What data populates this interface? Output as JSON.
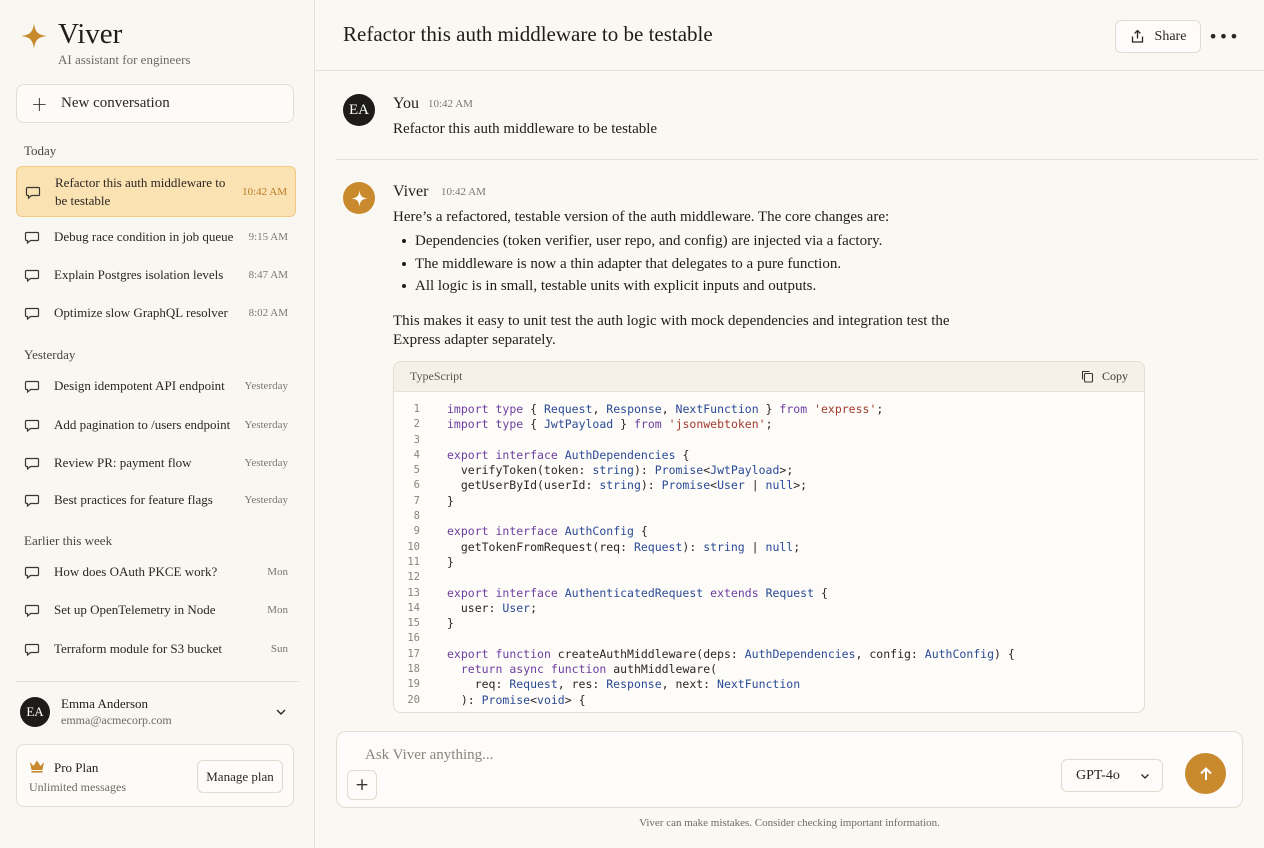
{
  "brand": {
    "name": "Viver",
    "tagline": "AI assistant for engineers"
  },
  "sidebar": {
    "new_conversation": "New conversation",
    "sections": [
      {
        "title": "Today"
      },
      {
        "title": "Yesterday"
      },
      {
        "title": "Earlier this week"
      }
    ],
    "items": [
      {
        "label": "Refactor this auth middleware to be testable",
        "time": "10:42 AM",
        "active": true
      },
      {
        "label": "Debug race condition in job queue",
        "time": "9:15 AM"
      },
      {
        "label": "Explain Postgres isolation levels",
        "time": "8:47 AM"
      },
      {
        "label": "Optimize slow GraphQL resolver",
        "time": "8:02 AM"
      },
      {
        "label": "Design idempotent API endpoint",
        "time": "Yesterday"
      },
      {
        "label": "Add pagination to /users endpoint",
        "time": "Yesterday"
      },
      {
        "label": "Review PR: payment flow",
        "time": "Yesterday"
      },
      {
        "label": "Best practices for feature flags",
        "time": "Yesterday"
      },
      {
        "label": "How does OAuth PKCE work?",
        "time": "Mon"
      },
      {
        "label": "Set up OpenTelemetry in Node",
        "time": "Mon"
      },
      {
        "label": "Terraform module for S3 bucket",
        "time": "Sun"
      }
    ],
    "user": {
      "initials": "EA",
      "name": "Emma Anderson",
      "email": "emma@acmecorp.com"
    },
    "plan": {
      "name": "Pro Plan",
      "sub": "Unlimited messages",
      "manage_label": "Manage plan"
    }
  },
  "header": {
    "title": "Refactor this auth middleware to be testable",
    "share_label": "Share",
    "more_label": "•••"
  },
  "messages": {
    "user": {
      "initials": "EA",
      "author": "You",
      "time": "10:42 AM",
      "text": "Refactor this auth middleware to be testable"
    },
    "assistant": {
      "author": "Viver",
      "time": "10:42 AM",
      "intro": "Here’s a refactored, testable version of the auth middleware. The core changes are:",
      "bullets": [
        "Dependencies (token verifier, user repo, and config) are injected via a factory.",
        "The middleware is now a thin adapter that delegates to a pure function.",
        "All logic is in small, testable units with explicit inputs and outputs."
      ],
      "para_line1": "This makes it easy to unit test the auth logic with mock dependencies and integration test the",
      "para_line2": "Express adapter separately.",
      "code": {
        "language": "TypeScript",
        "copy_label": "Copy",
        "lines": [
          "import type { Request, Response, NextFunction } from 'express';",
          "import type { JwtPayload } from 'jsonwebtoken';",
          "",
          "export interface AuthDependencies {",
          "  verifyToken(token: string): Promise<JwtPayload>;",
          "  getUserById(userId: string): Promise<User | null>;",
          "}",
          "",
          "export interface AuthConfig {",
          "  getTokenFromRequest(req: Request): string | null;",
          "}",
          "",
          "export interface AuthenticatedRequest extends Request {",
          "  user: User;",
          "}",
          "",
          "export function createAuthMiddleware(deps: AuthDependencies, config: AuthConfig) {",
          "  return async function authMiddleware(",
          "    req: Request, res: Response, next: NextFunction",
          "  ): Promise<void> {"
        ]
      }
    }
  },
  "composer": {
    "placeholder": "Ask Viver anything...",
    "model": "GPT-4o"
  },
  "disclaimer": "Viver can make mistakes. Consider checking important information.",
  "colors": {
    "accent": "#c88a2d",
    "active_bg": "#fbe2b3",
    "background": "#faf8f3"
  }
}
